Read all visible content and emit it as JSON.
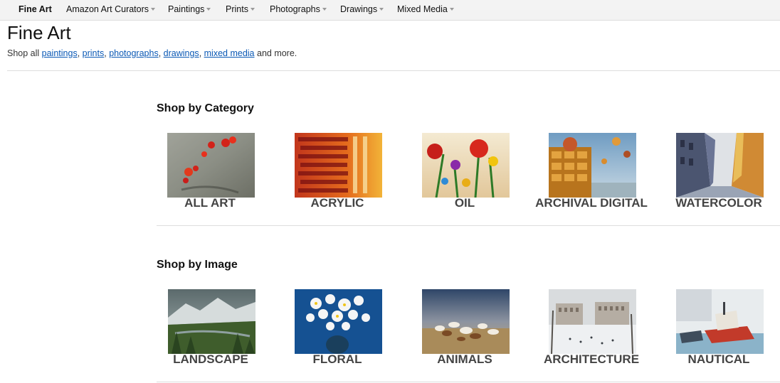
{
  "nav": {
    "items": [
      {
        "label": "Fine Art",
        "active": true,
        "dropdown": false
      },
      {
        "label": "Amazon Art Curators",
        "active": false,
        "dropdown": true
      },
      {
        "label": "Paintings",
        "active": false,
        "dropdown": true
      },
      {
        "label": "Prints",
        "active": false,
        "dropdown": true
      },
      {
        "label": "Photographs",
        "active": false,
        "dropdown": true
      },
      {
        "label": "Drawings",
        "active": false,
        "dropdown": true
      },
      {
        "label": "Mixed Media",
        "active": false,
        "dropdown": true
      }
    ]
  },
  "header": {
    "title": "Fine Art",
    "sub_prefix": "Shop all ",
    "links": [
      "paintings",
      "prints",
      "photographs",
      "drawings",
      "mixed media"
    ],
    "sub_suffix": " and more."
  },
  "category_section": {
    "title": "Shop by Category",
    "tiles": [
      {
        "label": "ALL ART",
        "image": "red-flowers-abstract-thumbnail"
      },
      {
        "label": "ACRYLIC",
        "image": "orange-letter-art-thumbnail"
      },
      {
        "label": "OIL",
        "image": "poppies-oil-thumbnail"
      },
      {
        "label": "ARCHIVAL DIGITAL",
        "image": "balloons-drawers-thumbnail"
      },
      {
        "label": "WATERCOLOR",
        "image": "street-watercolor-thumbnail"
      }
    ]
  },
  "image_section": {
    "title": "Shop by Image",
    "tiles": [
      {
        "label": "LANDSCAPE",
        "image": "mountain-forest-thumbnail"
      },
      {
        "label": "FLORAL",
        "image": "white-daisies-vase-thumbnail"
      },
      {
        "label": "ANIMALS",
        "image": "running-horses-thumbnail"
      },
      {
        "label": "ARCHITECTURE",
        "image": "winter-palace-thumbnail"
      },
      {
        "label": "NAUTICAL",
        "image": "harbor-boats-thumbnail"
      }
    ]
  },
  "colors": {
    "link": "#0b59b5",
    "nav_bg": "#f3f3f3",
    "label": "#444444"
  }
}
